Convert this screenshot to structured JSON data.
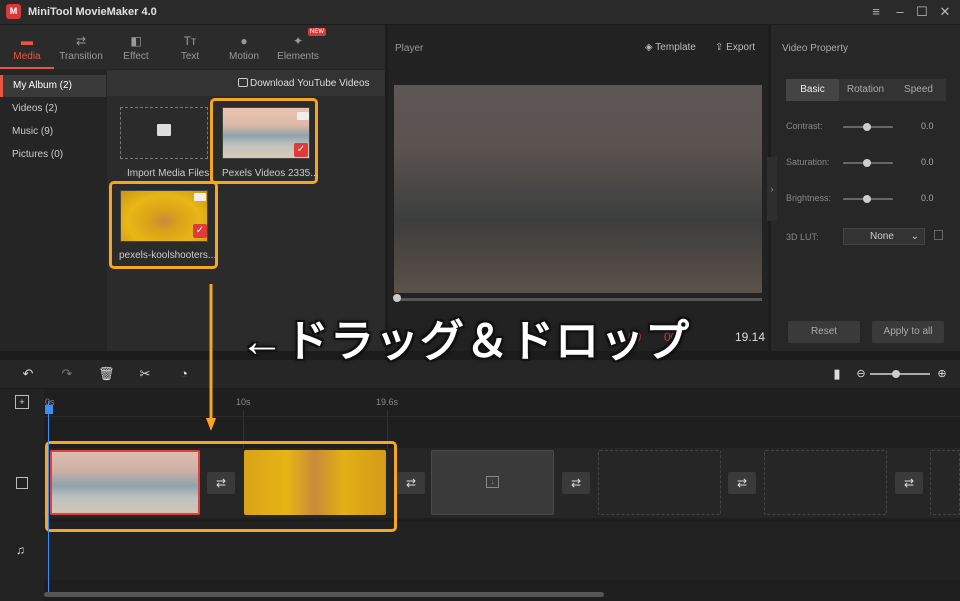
{
  "app": {
    "title": "MiniTool MovieMaker 4.0"
  },
  "toolbar": {
    "tabs": [
      {
        "label": "Media",
        "icon": "folder-icon",
        "active": true
      },
      {
        "label": "Transition",
        "icon": "transition-icon"
      },
      {
        "label": "Effect",
        "icon": "effect-icon"
      },
      {
        "label": "Text",
        "icon": "text-icon"
      },
      {
        "label": "Motion",
        "icon": "motion-icon"
      },
      {
        "label": "Elements",
        "icon": "elements-icon"
      }
    ],
    "new_badge": "NEW"
  },
  "album": {
    "items": [
      {
        "label": "My Album (2)",
        "active": true
      },
      {
        "label": "Videos (2)"
      },
      {
        "label": "Music (9)"
      },
      {
        "label": "Pictures (0)"
      }
    ]
  },
  "media": {
    "download_label": "Download YouTube Videos",
    "import_label": "Import Media Files",
    "items": [
      {
        "caption": "Pexels Videos 2335...",
        "selected": true
      },
      {
        "caption": "pexels-koolshooters...",
        "selected": true
      }
    ]
  },
  "player": {
    "label": "Player",
    "template_label": "Template",
    "export_label": "Export",
    "time_total": "19.14",
    "time_red": "00",
    "time_red2": "00"
  },
  "property": {
    "title": "Video Property",
    "tabs": [
      "Basic",
      "Rotation",
      "Speed"
    ],
    "contrast": {
      "label": "Contrast:",
      "value": "0.0"
    },
    "saturation": {
      "label": "Saturation:",
      "value": "0.0"
    },
    "brightness": {
      "label": "Brightness:",
      "value": "0.0"
    },
    "lut": {
      "label": "3D LUT:",
      "value": "None"
    },
    "reset_label": "Reset",
    "apply_label": "Apply to all"
  },
  "timeline": {
    "ticks": [
      "0s",
      "10s",
      "19.6s"
    ]
  },
  "annotation": {
    "text": "←ドラッグ＆ドロップ"
  },
  "colors": {
    "accent": "#e8573f",
    "highlight": "#f5a623",
    "check": "#e03a3a",
    "playhead": "#3e8ef7"
  }
}
